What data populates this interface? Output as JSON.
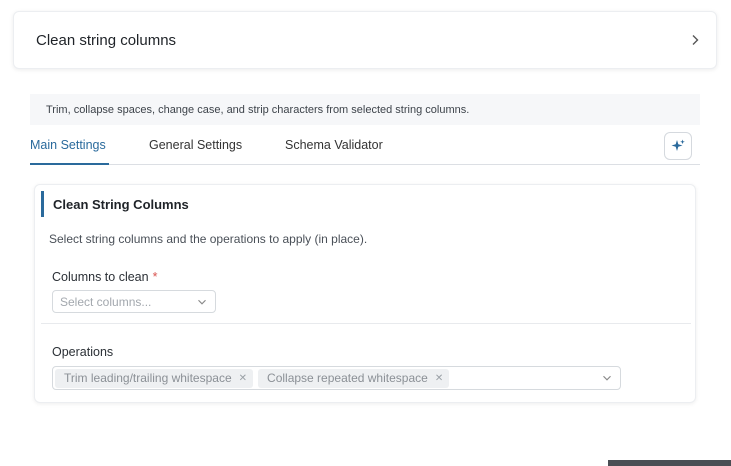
{
  "header": {
    "title": "Clean string columns"
  },
  "description": "Trim, collapse spaces, change case, and strip characters from selected string columns.",
  "tabs": [
    {
      "label": "Main Settings",
      "active": true
    },
    {
      "label": "General Settings",
      "active": false
    },
    {
      "label": "Schema Validator",
      "active": false
    }
  ],
  "ai_button": {
    "icon": "sparkle-icon"
  },
  "panel": {
    "title": "Clean String Columns",
    "description": "Select string columns and the operations to apply (in place).",
    "columns_field": {
      "label": "Columns to clean",
      "required_mark": "*",
      "placeholder": "Select columns..."
    },
    "operations_field": {
      "label": "Operations",
      "selected": [
        "Trim leading/trailing whitespace",
        "Collapse repeated whitespace"
      ]
    }
  },
  "colors": {
    "accent": "#2a6a9c",
    "required": "#d9534f"
  }
}
